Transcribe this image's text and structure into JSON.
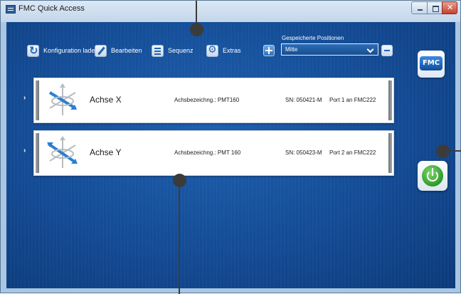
{
  "window": {
    "title": "FMC Quick Access"
  },
  "toolbar": {
    "load_config_label": "Konfiguration laden",
    "edit_label": "Bearbeiten",
    "sequence_label": "Sequenz",
    "extras_label": "Extras"
  },
  "saved_positions": {
    "label": "Gespeicherte Positionen",
    "selected": "Mitte"
  },
  "logo": {
    "text": "FMC"
  },
  "axes": [
    {
      "name": "Achse X",
      "description": "Achsbezeichng.: PMT160",
      "serial": "SN: 050421-M",
      "port": "Port 1 an FMC222"
    },
    {
      "name": "Achse Y",
      "description": "Achsbezeichng.: PMT 160",
      "serial": "SN: 050423-M",
      "port": "Port 2 an FMC222"
    }
  ],
  "icons": {
    "expand": "›",
    "refresh": "refresh-icon",
    "edit": "pencil-icon",
    "sequence": "list-icon",
    "extras": "gear-icon",
    "add": "plus-icon",
    "remove": "minus-icon",
    "power": "power-icon"
  },
  "colors": {
    "background": "#154f9a",
    "accent": "#1d66b4",
    "power_green": "#2e9a2a"
  }
}
